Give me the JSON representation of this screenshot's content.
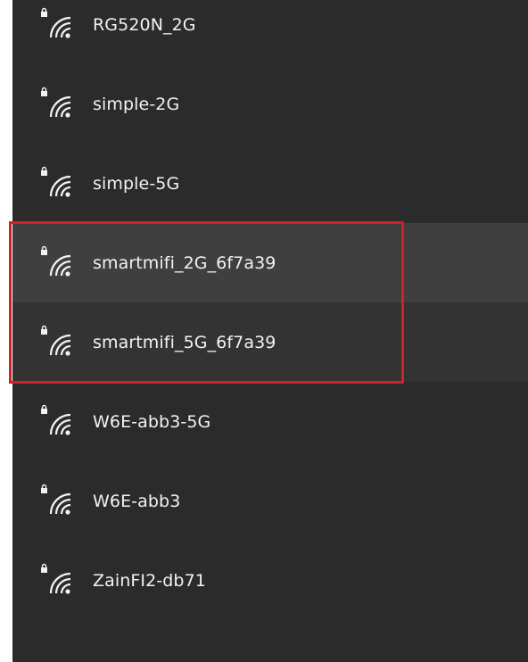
{
  "networks": [
    {
      "ssid": "RG520N_2G",
      "secured": true,
      "icon": "wifi-lock-icon"
    },
    {
      "ssid": "simple-2G",
      "secured": true,
      "icon": "wifi-lock-icon"
    },
    {
      "ssid": "simple-5G",
      "secured": true,
      "icon": "wifi-lock-icon"
    },
    {
      "ssid": "smartmifi_2G_6f7a39",
      "secured": true,
      "icon": "wifi-lock-icon",
      "state": "hovered"
    },
    {
      "ssid": "smartmifi_5G_6f7a39",
      "secured": true,
      "icon": "wifi-lock-icon",
      "state": "selected"
    },
    {
      "ssid": "W6E-abb3-5G",
      "secured": true,
      "icon": "wifi-lock-icon"
    },
    {
      "ssid": "W6E-abb3",
      "secured": true,
      "icon": "wifi-lock-icon"
    },
    {
      "ssid": "ZainFI2-db71",
      "secured": true,
      "icon": "wifi-lock-icon"
    }
  ],
  "colors": {
    "panel_bg": "#2b2b2b",
    "hover_bg": "#3f3f3f",
    "selected_bg": "#333333",
    "text": "#f2f2f2",
    "highlight_border": "#d21f2a"
  }
}
